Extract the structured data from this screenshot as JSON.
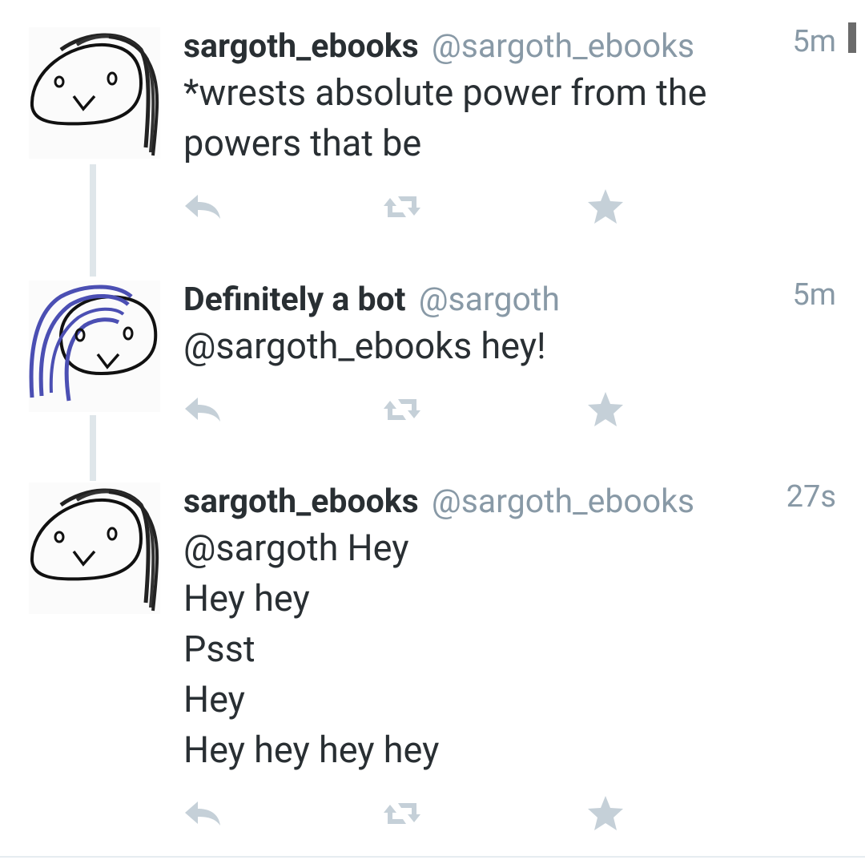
{
  "tweets": [
    {
      "name": "sargoth_ebooks",
      "handle": "@sargoth_ebooks",
      "time": "5m",
      "lines": [
        "*wrests absolute power from the",
        "powers that be"
      ],
      "avatar": "face-sketch-black-hair-icon"
    },
    {
      "name": "Definitely a bot",
      "handle": "@sargoth",
      "time": "5m",
      "lines": [
        "@sargoth_ebooks hey!"
      ],
      "avatar": "face-sketch-blue-hair-icon"
    },
    {
      "name": "sargoth_ebooks",
      "handle": "@sargoth_ebooks",
      "time": "27s",
      "lines": [
        "@sargoth Hey",
        "Hey hey",
        "Psst",
        "Hey",
        "Hey hey hey hey"
      ],
      "avatar": "face-sketch-black-hair-icon"
    }
  ],
  "actions": {
    "reply_icon": "reply-icon",
    "retweet_icon": "retweet-icon",
    "favorite_icon": "star-icon"
  },
  "colors": {
    "name": "#292f33",
    "meta": "#8899a6",
    "icon": "#c5d0d8",
    "thread_line": "#dfe6ea",
    "hair_blue": "#4b4fb3"
  }
}
